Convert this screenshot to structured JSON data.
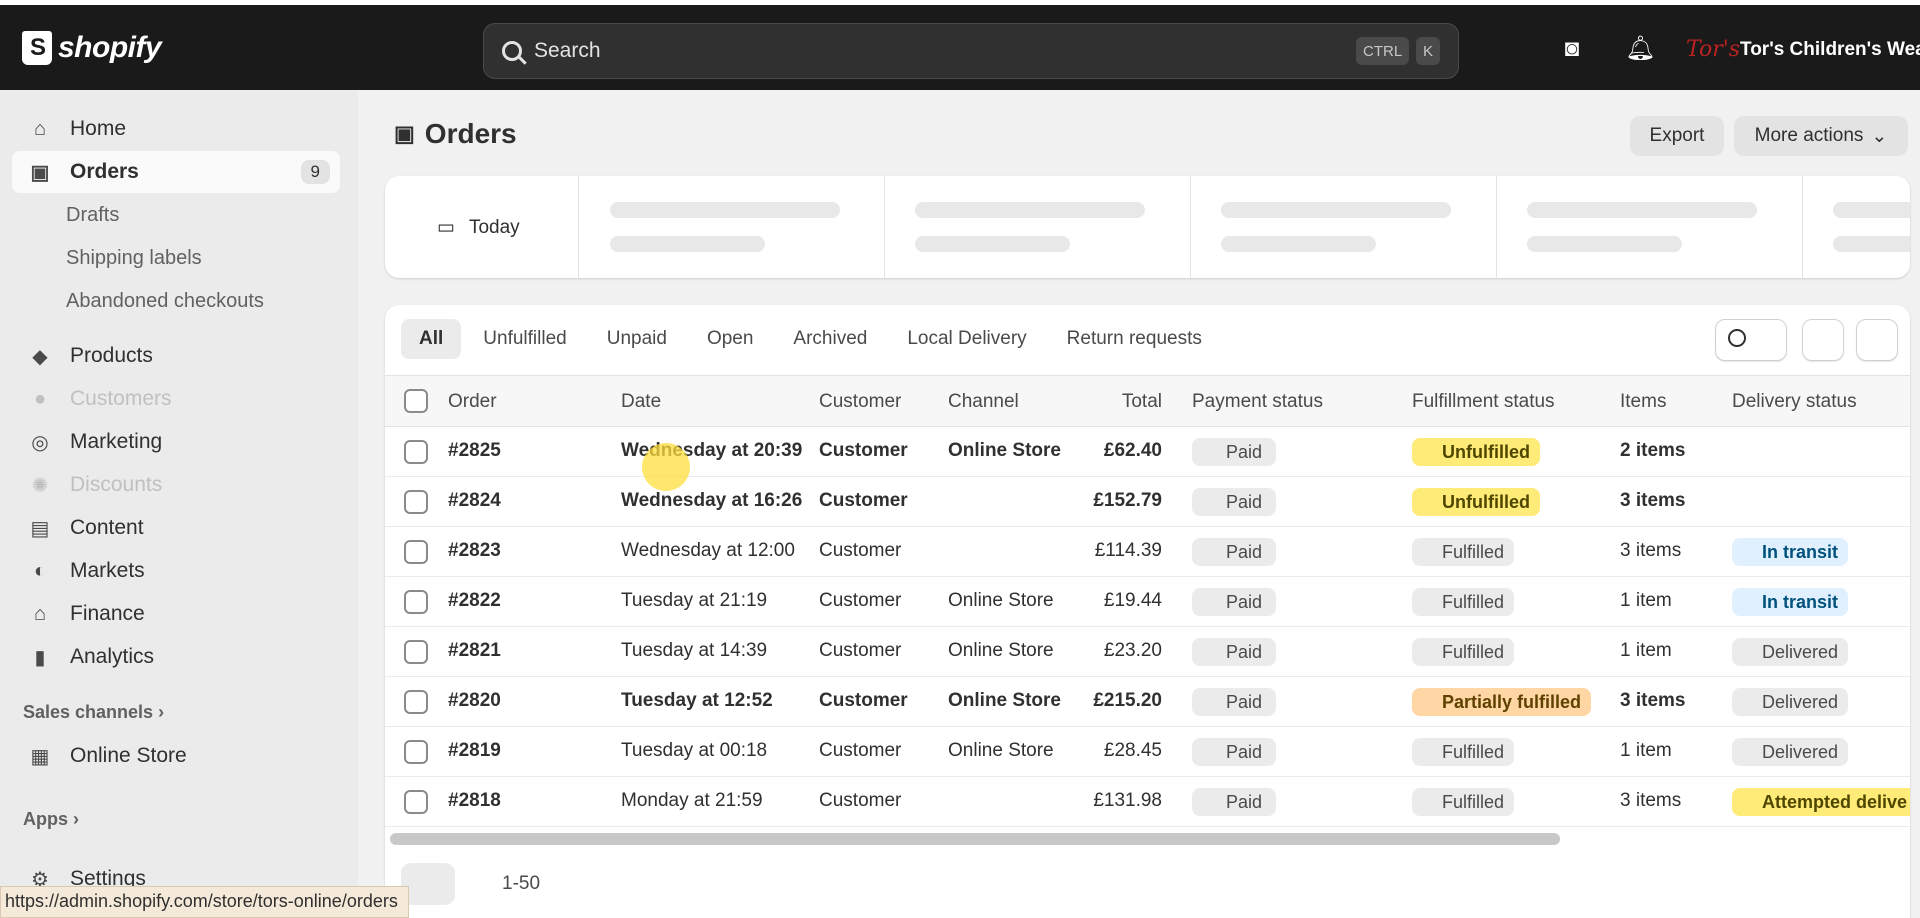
{
  "topbar": {
    "logo_text": "shopify",
    "search_placeholder": "Search",
    "kbd1": "CTRL",
    "kbd2": "K",
    "store_logo_text": "Tor's",
    "store_name": "Tor's Children's Wear"
  },
  "sidebar": {
    "items": [
      {
        "label": "Home",
        "icon": "home-icon"
      },
      {
        "label": "Orders",
        "icon": "inbox-icon",
        "count": "9"
      },
      {
        "label": "Drafts"
      },
      {
        "label": "Shipping labels"
      },
      {
        "label": "Abandoned checkouts"
      },
      {
        "label": "Products",
        "icon": "tag-icon"
      },
      {
        "label": "Customers",
        "icon": "person-icon"
      },
      {
        "label": "Marketing",
        "icon": "target-icon"
      },
      {
        "label": "Discounts",
        "icon": "discount-icon"
      },
      {
        "label": "Content",
        "icon": "content-icon"
      },
      {
        "label": "Markets",
        "icon": "globe-icon"
      },
      {
        "label": "Finance",
        "icon": "bank-icon"
      },
      {
        "label": "Analytics",
        "icon": "bar-chart-icon"
      },
      {
        "label": "Online Store",
        "icon": "store-icon"
      },
      {
        "label": "Settings",
        "icon": "gear-icon"
      }
    ],
    "sales_channels": "Sales channels",
    "apps": "Apps"
  },
  "status_url": "https://admin.shopify.com/store/tors-online/orders",
  "main": {
    "title": "Orders",
    "export_label": "Export",
    "more_actions_label": "More actions",
    "today_label": "Today",
    "tabs": [
      "All",
      "Unfulfilled",
      "Unpaid",
      "Open",
      "Archived",
      "Local Delivery",
      "Return requests"
    ],
    "columns": [
      "Order",
      "Date",
      "Customer",
      "Channel",
      "Total",
      "Payment status",
      "Fulfillment status",
      "Items",
      "Delivery status"
    ],
    "orders": [
      {
        "order": "#2825",
        "date": "Wednesday at 20:39",
        "customer": "Customer",
        "channel": "Online Store",
        "total": "£62.40",
        "payment": "Paid",
        "fulfillment": "Unfulfilled",
        "items": "2 items",
        "delivery": ""
      },
      {
        "order": "#2824",
        "date": "Wednesday at 16:26",
        "customer": "Customer",
        "channel": "",
        "total": "£152.79",
        "payment": "Paid",
        "fulfillment": "Unfulfilled",
        "items": "3 items",
        "delivery": ""
      },
      {
        "order": "#2823",
        "date": "Wednesday at 12:00",
        "customer": "Customer",
        "channel": "",
        "total": "£114.39",
        "payment": "Paid",
        "fulfillment": "Fulfilled",
        "items": "3 items",
        "delivery": "In transit"
      },
      {
        "order": "#2822",
        "date": "Tuesday at 21:19",
        "customer": "Customer",
        "channel": "Online Store",
        "total": "£19.44",
        "payment": "Paid",
        "fulfillment": "Fulfilled",
        "items": "1 item",
        "delivery": "In transit"
      },
      {
        "order": "#2821",
        "date": "Tuesday at 14:39",
        "customer": "Customer",
        "channel": "Online Store",
        "total": "£23.20",
        "payment": "Paid",
        "fulfillment": "Fulfilled",
        "items": "1 item",
        "delivery": "Delivered"
      },
      {
        "order": "#2820",
        "date": "Tuesday at 12:52",
        "customer": "Customer",
        "channel": "Online Store",
        "total": "£215.20",
        "payment": "Paid",
        "fulfillment": "Partially fulfilled",
        "items": "3 items",
        "delivery": "Delivered"
      },
      {
        "order": "#2819",
        "date": "Tuesday at 00:18",
        "customer": "Customer",
        "channel": "Online Store",
        "total": "£28.45",
        "payment": "Paid",
        "fulfillment": "Fulfilled",
        "items": "1 item",
        "delivery": "Delivered"
      },
      {
        "order": "#2818",
        "date": "Monday at 21:59",
        "customer": "Customer",
        "channel": "",
        "total": "£131.98",
        "payment": "Paid",
        "fulfillment": "Fulfilled",
        "items": "3 items",
        "delivery": "Attempted delive"
      }
    ],
    "pagination_label": "1-50"
  }
}
